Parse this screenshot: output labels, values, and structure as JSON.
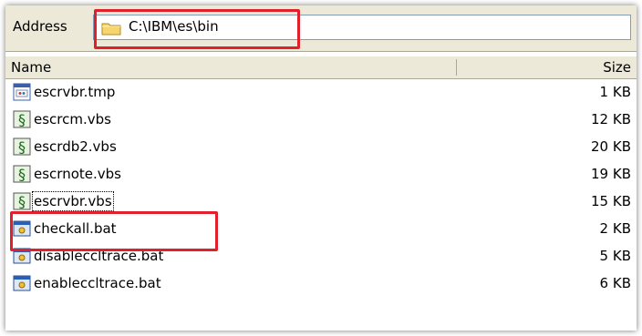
{
  "address": {
    "label": "Address",
    "value": "C:\\IBM\\es\\bin",
    "icon": "folder-icon"
  },
  "columns": {
    "name": "Name",
    "size": "Size"
  },
  "files": [
    {
      "name": "escrvbr.tmp",
      "size": "1 KB",
      "icon": "tmp-file-icon"
    },
    {
      "name": "escrcm.vbs",
      "size": "12 KB",
      "icon": "vbscript-icon"
    },
    {
      "name": "escrdb2.vbs",
      "size": "20 KB",
      "icon": "vbscript-icon"
    },
    {
      "name": "escrnote.vbs",
      "size": "19 KB",
      "icon": "vbscript-icon"
    },
    {
      "name": "escrvbr.vbs",
      "size": "15 KB",
      "icon": "vbscript-icon"
    },
    {
      "name": "checkall.bat",
      "size": "2 KB",
      "icon": "batch-file-icon"
    },
    {
      "name": "disableccltrace.bat",
      "size": "5 KB",
      "icon": "batch-file-icon"
    },
    {
      "name": "enableccltrace.bat",
      "size": "6 KB",
      "icon": "batch-file-icon"
    }
  ],
  "colors": {
    "highlight": "#e0202a",
    "toolbar": "#ece9d8"
  }
}
